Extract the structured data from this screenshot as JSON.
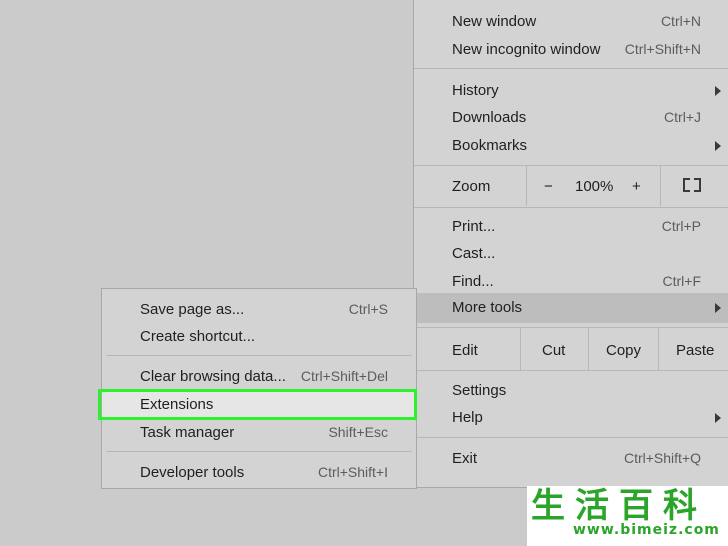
{
  "main_menu": {
    "new_window": {
      "label": "New window",
      "shortcut": "Ctrl+N"
    },
    "new_incognito": {
      "label": "New incognito window",
      "shortcut": "Ctrl+Shift+N"
    },
    "history": {
      "label": "History"
    },
    "downloads": {
      "label": "Downloads",
      "shortcut": "Ctrl+J"
    },
    "bookmarks": {
      "label": "Bookmarks"
    },
    "zoom": {
      "label": "Zoom",
      "minus": "−",
      "level": "100%",
      "plus": "+"
    },
    "print": {
      "label": "Print...",
      "shortcut": "Ctrl+P"
    },
    "cast": {
      "label": "Cast..."
    },
    "find": {
      "label": "Find...",
      "shortcut": "Ctrl+F"
    },
    "more_tools": {
      "label": "More tools"
    },
    "edit": {
      "label": "Edit",
      "cut": "Cut",
      "copy": "Copy",
      "paste": "Paste"
    },
    "settings": {
      "label": "Settings"
    },
    "help": {
      "label": "Help"
    },
    "exit": {
      "label": "Exit",
      "shortcut": "Ctrl+Shift+Q"
    }
  },
  "sub_menu": {
    "save_page": {
      "label": "Save page as...",
      "shortcut": "Ctrl+S"
    },
    "create_shortcut": {
      "label": "Create shortcut..."
    },
    "clear_browsing": {
      "label": "Clear browsing data...",
      "shortcut": "Ctrl+Shift+Del"
    },
    "extensions": {
      "label": "Extensions"
    },
    "task_manager": {
      "label": "Task manager",
      "shortcut": "Shift+Esc"
    },
    "developer_tools": {
      "label": "Developer tools",
      "shortcut": "Ctrl+Shift+I"
    }
  },
  "colors": {
    "highlight_box": "#2ef12e",
    "menu_bg": "#d3d3d3",
    "hover_bg": "#bdbdbd"
  },
  "watermark": {
    "chars": "生活百科",
    "url": "www.bimeiz.com"
  }
}
